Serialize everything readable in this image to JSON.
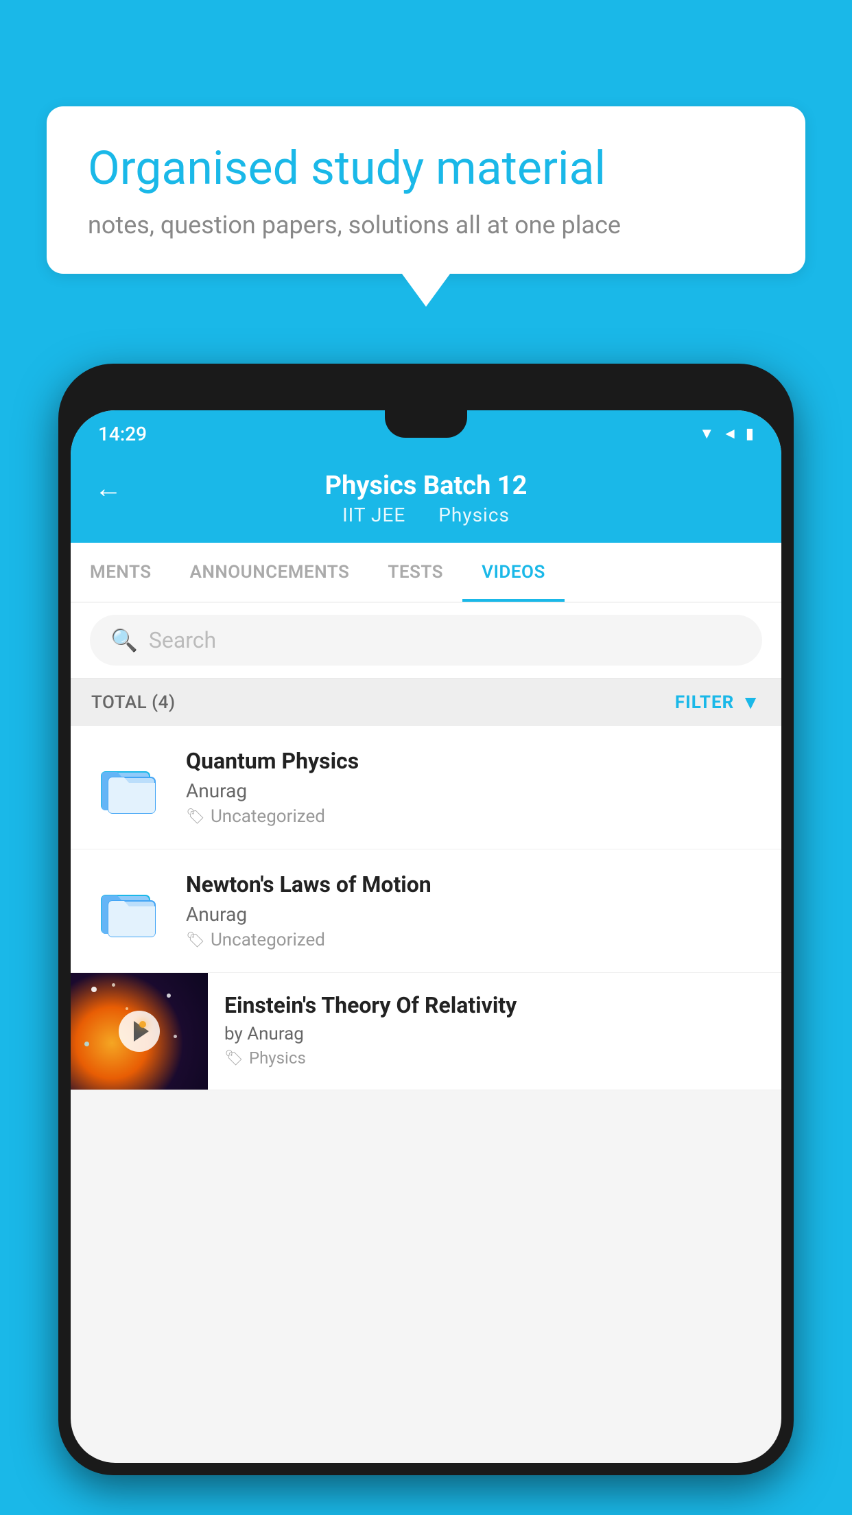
{
  "bubble": {
    "title": "Organised study material",
    "subtitle": "notes, question papers, solutions all at one place"
  },
  "status_bar": {
    "time": "14:29",
    "wifi": "▼",
    "signal": "▲",
    "battery": "▌"
  },
  "header": {
    "title": "Physics Batch 12",
    "subtitle_left": "IIT JEE",
    "subtitle_right": "Physics",
    "back_label": "←"
  },
  "tabs": [
    {
      "label": "MENTS",
      "active": false
    },
    {
      "label": "ANNOUNCEMENTS",
      "active": false
    },
    {
      "label": "TESTS",
      "active": false
    },
    {
      "label": "VIDEOS",
      "active": true
    }
  ],
  "search": {
    "placeholder": "Search"
  },
  "filter": {
    "total_label": "TOTAL (4)",
    "filter_label": "FILTER"
  },
  "videos": [
    {
      "id": 1,
      "title": "Quantum Physics",
      "author": "Anurag",
      "tag": "Uncategorized",
      "type": "folder"
    },
    {
      "id": 2,
      "title": "Newton's Laws of Motion",
      "author": "Anurag",
      "tag": "Uncategorized",
      "type": "folder"
    },
    {
      "id": 3,
      "title": "Einstein's Theory Of Relativity",
      "author": "by Anurag",
      "tag": "Physics",
      "type": "video"
    }
  ]
}
